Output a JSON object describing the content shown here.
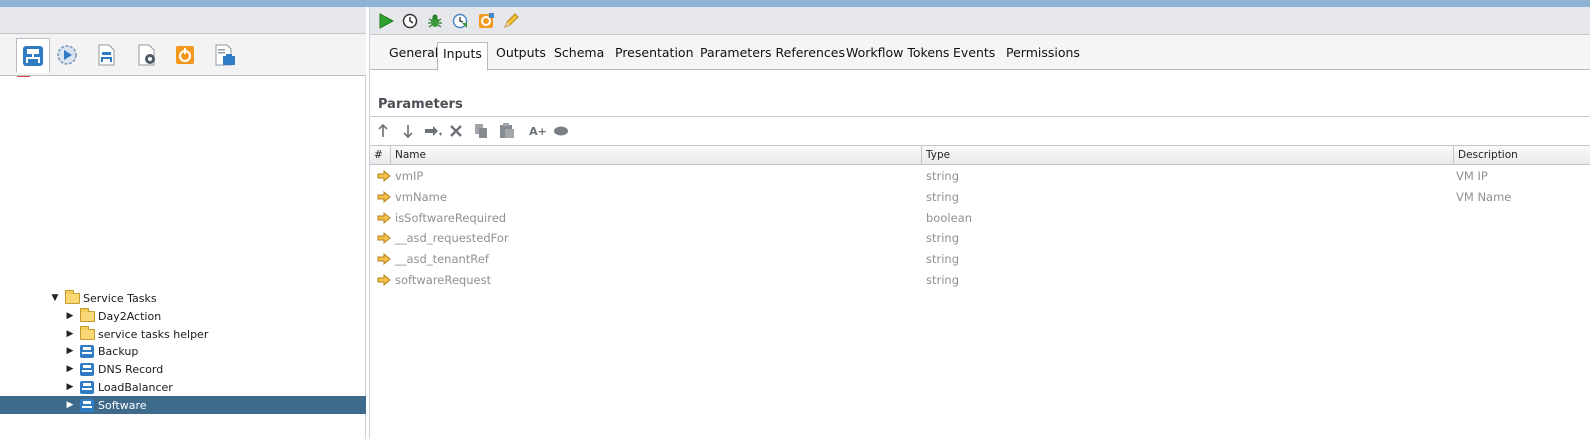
{
  "left_panel": {
    "tabs": [
      {
        "name": "workflows-tab-icon",
        "active": true
      },
      {
        "name": "run-tab-icon",
        "active": false
      },
      {
        "name": "design-tab-icon",
        "active": false
      },
      {
        "name": "actions-tab-icon",
        "active": false
      },
      {
        "name": "resources-tab-icon",
        "active": false
      },
      {
        "name": "packages-tab-icon",
        "active": false
      }
    ],
    "tree": [
      {
        "label": "Service Tasks",
        "type": "folder",
        "expanded": true,
        "depth": 0
      },
      {
        "label": "Day2Action",
        "type": "folder",
        "expanded": false,
        "depth": 1
      },
      {
        "label": "service tasks helper",
        "type": "folder",
        "expanded": false,
        "depth": 1
      },
      {
        "label": "Backup",
        "type": "workflow",
        "expanded": false,
        "depth": 1
      },
      {
        "label": "DNS Record",
        "type": "workflow",
        "expanded": false,
        "depth": 1
      },
      {
        "label": "LoadBalancer",
        "type": "workflow",
        "expanded": false,
        "depth": 1
      },
      {
        "label": "Software",
        "type": "workflow",
        "expanded": false,
        "depth": 1,
        "selected": true
      }
    ]
  },
  "toolbar": {
    "buttons": [
      "run-icon",
      "clock-icon",
      "debug-icon",
      "schedule-icon",
      "validate-icon",
      "edit-icon"
    ]
  },
  "tabs": [
    "General",
    "Inputs",
    "Outputs",
    "Schema",
    "Presentation",
    "Parameters References",
    "Workflow Tokens",
    "Events",
    "Permissions"
  ],
  "active_tab": "Inputs",
  "parameters": {
    "title": "Parameters",
    "tools": [
      "move-up-icon",
      "move-down-icon",
      "move-to-icon",
      "delete-icon",
      "copy-icon",
      "paste-icon",
      "add-attribute-icon",
      "bind-icon"
    ],
    "add_label": "A+",
    "columns": {
      "index": "#",
      "name": "Name",
      "type": "Type",
      "description": "Description"
    },
    "rows": [
      {
        "name": "vmIP",
        "type": "string",
        "description": "VM IP"
      },
      {
        "name": "vmName",
        "type": "string",
        "description": "VM Name"
      },
      {
        "name": "isSoftwareRequired",
        "type": "boolean",
        "description": ""
      },
      {
        "name": "__asd_requestedFor",
        "type": "string",
        "description": ""
      },
      {
        "name": "__asd_tenantRef",
        "type": "string",
        "description": ""
      },
      {
        "name": "softwareRequest",
        "type": "string",
        "description": ""
      }
    ]
  }
}
